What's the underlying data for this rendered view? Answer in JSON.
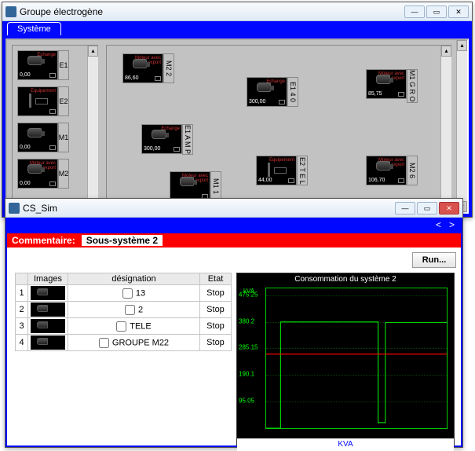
{
  "main_window": {
    "title": "Groupe électrogène",
    "tab": "Système",
    "equipment": [
      {
        "id": "E1",
        "value": "0,00",
        "kind": "motor",
        "red": "Echange"
      },
      {
        "id": "E2",
        "value": "",
        "kind": "bars",
        "red": "Equipement"
      },
      {
        "id": "M1",
        "value": "0,00",
        "kind": "motor",
        "red": ""
      },
      {
        "id": "M2",
        "value": "0,00",
        "kind": "motor",
        "red": "Moteur avec export"
      },
      {
        "id": "M2 2",
        "value": "86,60",
        "kind": "motor",
        "red": "Moteur avec export"
      },
      {
        "id": "E1 4 0",
        "value": "300,00",
        "kind": "motor",
        "red": "Echange"
      },
      {
        "id": "M1 G R O",
        "value": "85,75",
        "kind": "motor",
        "red": "Moteur avec export"
      },
      {
        "id": "E1 A M P",
        "value": "300,00",
        "kind": "motor",
        "red": "Echange"
      },
      {
        "id": "E2 T E L",
        "value": "44,00",
        "kind": "bars",
        "red": "Equipement"
      },
      {
        "id": "M2 6",
        "value": "106,70",
        "kind": "motor",
        "red": "Moteur avec export"
      },
      {
        "id": "M1 1",
        "value": "",
        "kind": "motor",
        "red": "Moteur avec export"
      }
    ]
  },
  "sim_window": {
    "title": "CS_Sim",
    "nav_prev": "<",
    "nav_next": ">",
    "commentaire_label": "Commentaire:",
    "commentaire_value": "Sous-système 2",
    "run_label": "Run...",
    "columns": {
      "images": "Images",
      "designation": "désignation",
      "etat": "Etat"
    },
    "rows": [
      {
        "n": "1",
        "designation": "13",
        "etat": "Stop"
      },
      {
        "n": "2",
        "designation": "2",
        "etat": "Stop"
      },
      {
        "n": "3",
        "designation": "TELE",
        "etat": "Stop"
      },
      {
        "n": "4",
        "designation": "GROUPE M22",
        "etat": "Stop"
      }
    ]
  },
  "chart_data": {
    "type": "line",
    "title": "Consommation du système 2",
    "y_unit": "kVA",
    "xlabel": "KVA",
    "ylim": [
      0,
      500
    ],
    "yticks": [
      95.05,
      190.1,
      285.15,
      380.2,
      475.25
    ],
    "series": [
      {
        "name": "green",
        "color": "#00d000",
        "x": [
          0,
          8,
          8,
          62,
          62,
          66,
          66,
          100
        ],
        "y": [
          0,
          0,
          380,
          380,
          20,
          20,
          378,
          378
        ]
      },
      {
        "name": "red",
        "color": "#ff0000",
        "x": [
          0,
          100
        ],
        "y": [
          265,
          265
        ]
      }
    ]
  }
}
